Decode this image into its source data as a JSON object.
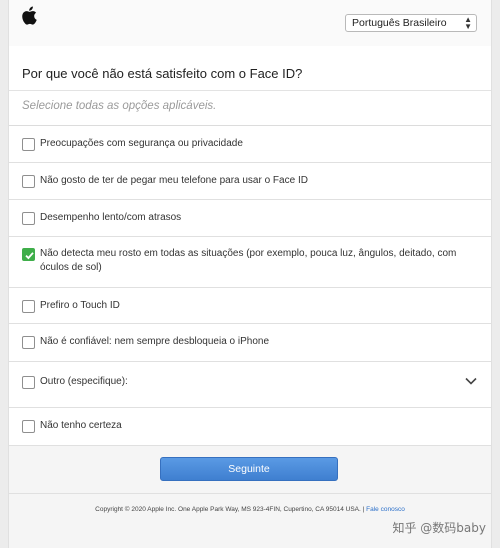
{
  "header": {
    "language_selected": "Português Brasileiro"
  },
  "survey": {
    "question": "Por que você não está satisfeito com o Face ID?",
    "instruction": "Selecione todas as opções aplicáveis.",
    "options": [
      {
        "label": "Preocupações com segurança ou privacidade",
        "checked": false
      },
      {
        "label": "Não gosto de ter de pegar meu telefone para usar o Face ID",
        "checked": false
      },
      {
        "label": "Desempenho lento/com atrasos",
        "checked": false
      },
      {
        "label": "Não detecta meu rosto em todas as situações (por exemplo, pouca luz, ângulos, deitado, com óculos de sol)",
        "checked": true
      },
      {
        "label": "Prefiro o Touch ID",
        "checked": false
      },
      {
        "label": "Não é confiável: nem sempre desbloqueia o iPhone",
        "checked": false
      },
      {
        "label": "Outro (especifique):",
        "checked": false,
        "expandable": true
      },
      {
        "label": "Não tenho certeza",
        "checked": false
      }
    ],
    "next_label": "Seguinte"
  },
  "footer": {
    "copyright": "Copyright © 2020 Apple Inc. One Apple Park Way, MS 923-4FIN, Cupertino, CA 95014 USA.",
    "separator": "|",
    "contact_label": "Fale conosco"
  },
  "watermark": "知乎 @数码baby",
  "colors": {
    "checked": "#3fae4a",
    "button": "#4a8ad9",
    "link": "#2b6fc9"
  },
  "icons": {
    "logo": "apple-logo",
    "check": "check-icon",
    "expand": "chevron-down-icon",
    "select": "up-down-arrows-icon"
  }
}
